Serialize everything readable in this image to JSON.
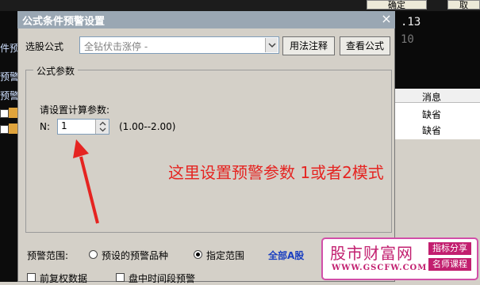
{
  "background": {
    "top_buttons": [
      "确定",
      "取"
    ],
    "side_labels": [
      "件预",
      "预警",
      "预警"
    ],
    "right_numbers": [
      ".13",
      "10"
    ],
    "table": {
      "header": "消息",
      "rows": [
        "缺省",
        "缺省"
      ]
    }
  },
  "dialog": {
    "title": "公式条件预警设置",
    "close": "×",
    "formula_label": "选股公式",
    "formula_value": "全钻伏击涨停 -",
    "usage_button": "用法注释",
    "view_button": "查看公式",
    "params_group": "公式参数",
    "params_prompt": "请设置计算参数:",
    "param_name": "N:",
    "param_value": "1",
    "param_range": "(1.00--2.00)",
    "annotation": "这里设置预警参数 1或者2模式",
    "scope_label": "预警范围:",
    "scope_options": [
      "预设的预警品种",
      "指定范围"
    ],
    "scope_selected": 1,
    "all_a_link": "全部A股",
    "bottom_checks": [
      "前复权数据",
      "盘中时间段预警"
    ]
  },
  "watermark": {
    "title": "股市财富网",
    "url": "WWW.GSCFW.COM",
    "badges": [
      "指标分享",
      "名师课程"
    ]
  },
  "colors": {
    "annotation": "#e52421",
    "watermark": "#c21f6f",
    "link": "#1a3fc0"
  }
}
